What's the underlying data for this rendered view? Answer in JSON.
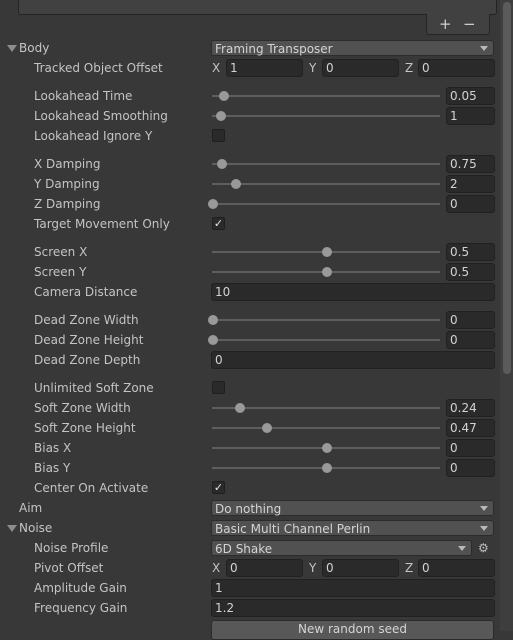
{
  "toolbar": {
    "add_label": "+",
    "remove_label": "−"
  },
  "body": {
    "label": "Body",
    "value": "Framing Transposer",
    "tracked_object_offset": {
      "label": "Tracked Object Offset",
      "x_label": "X",
      "x": "1",
      "y_label": "Y",
      "y": "0",
      "z_label": "Z",
      "z": "0"
    },
    "sliders": [
      {
        "label": "Lookahead Time",
        "value": "0.05",
        "fraction": 0.05
      },
      {
        "label": "Lookahead Smoothing",
        "value": "1",
        "fraction": 0.033
      },
      {
        "label": "X Damping",
        "value": "0.75",
        "fraction": 0.038
      },
      {
        "label": "Y Damping",
        "value": "2",
        "fraction": 0.1
      },
      {
        "label": "Z Damping",
        "value": "0",
        "fraction": 0.0
      },
      {
        "label": "Screen X",
        "value": "0.5",
        "fraction": 0.5
      },
      {
        "label": "Screen Y",
        "value": "0.5",
        "fraction": 0.5
      },
      {
        "label": "Dead Zone Width",
        "value": "0",
        "fraction": 0.0
      },
      {
        "label": "Dead Zone Height",
        "value": "0",
        "fraction": 0.0
      },
      {
        "label": "Soft Zone Width",
        "value": "0.24",
        "fraction": 0.12
      },
      {
        "label": "Soft Zone Height",
        "value": "0.47",
        "fraction": 0.235
      },
      {
        "label": "Bias X",
        "value": "0",
        "fraction": 0.5
      },
      {
        "label": "Bias Y",
        "value": "0",
        "fraction": 0.5
      }
    ],
    "lookahead_ignore_y": {
      "label": "Lookahead Ignore Y",
      "checked": false
    },
    "target_movement_only": {
      "label": "Target Movement Only",
      "checked": true
    },
    "camera_distance": {
      "label": "Camera Distance",
      "value": "10"
    },
    "dead_zone_depth": {
      "label": "Dead Zone Depth",
      "value": "0"
    },
    "unlimited_soft_zone": {
      "label": "Unlimited Soft Zone",
      "checked": false
    },
    "center_on_activate": {
      "label": "Center On Activate",
      "checked": true
    }
  },
  "aim": {
    "label": "Aim",
    "value": "Do nothing"
  },
  "noise": {
    "label": "Noise",
    "value": "Basic Multi Channel Perlin",
    "noise_profile": {
      "label": "Noise Profile",
      "value": "6D Shake",
      "icon": "gear-icon"
    },
    "pivot_offset": {
      "label": "Pivot Offset",
      "x_label": "X",
      "x": "0",
      "y_label": "Y",
      "y": "0",
      "z_label": "Z",
      "z": "0"
    },
    "amplitude_gain": {
      "label": "Amplitude Gain",
      "value": "1"
    },
    "frequency_gain": {
      "label": "Frequency Gain",
      "value": "1.2"
    },
    "random_seed_button": "New random seed"
  },
  "colors": {
    "background": "#383838",
    "field": "#2a2a2a",
    "dropdown": "#515151",
    "knob": "#999999"
  }
}
